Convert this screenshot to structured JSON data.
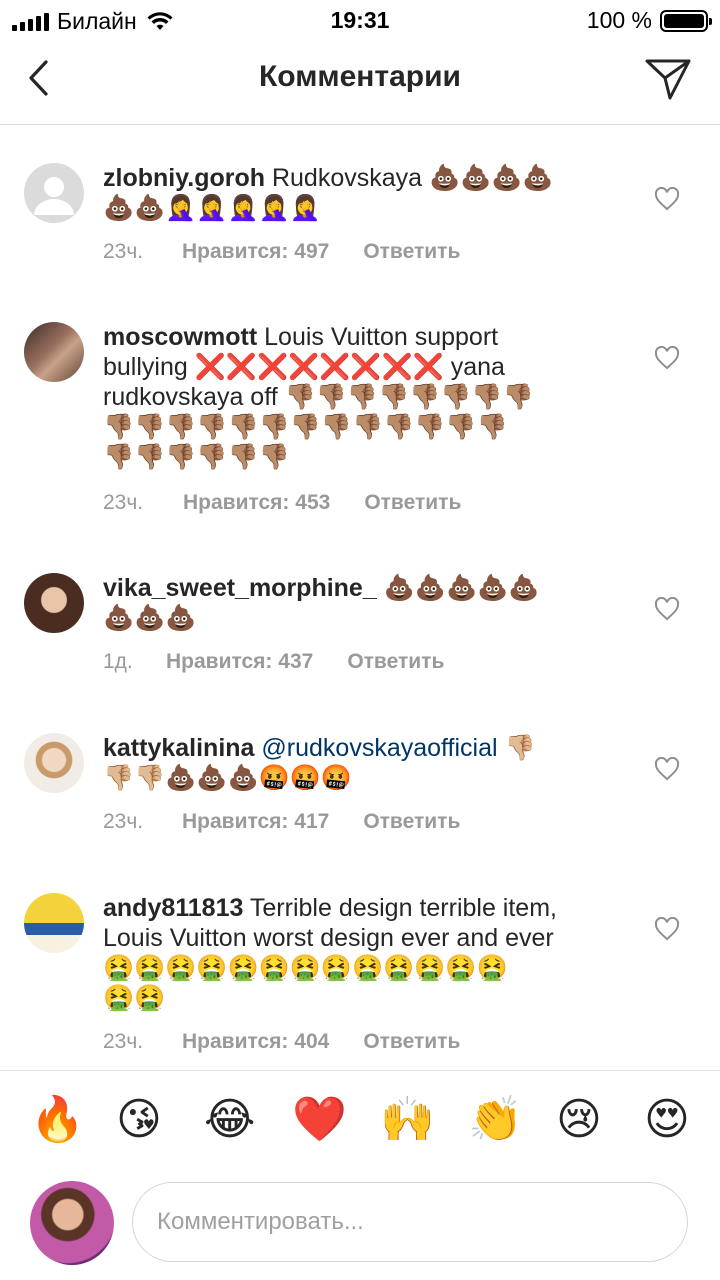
{
  "status": {
    "carrier": "Билайн",
    "time": "19:31",
    "battery": "100 %"
  },
  "nav": {
    "title": "Комментарии"
  },
  "comments": [
    {
      "username": "zlobniy.goroh",
      "text_line1": "Rudkovskaya 💩💩💩💩",
      "text_line2": "💩💩🤦‍♀️🤦‍♀️🤦‍♀️🤦‍♀️🤦‍♀️",
      "time": "23ч.",
      "likes": "Нравится: 497",
      "reply": "Ответить"
    },
    {
      "username": "moscowmott",
      "text_line1": "Louis Vuitton support",
      "text_line2": "bullying ❌❌❌❌❌❌❌❌ yana",
      "text_line3": "rudkovskaya off 👎🏽👎🏽👎🏽👎🏽👎🏽👎🏽👎🏽👎🏽",
      "text_line4": "👎🏽👎🏽👎🏽👎🏽👎🏽👎🏽👎🏽👎🏽👎🏽👎🏽👎🏽👎🏽👎🏽",
      "text_line5": "👎🏽👎🏽👎🏽👎🏽👎🏽👎🏽",
      "time": "23ч.",
      "likes": "Нравится: 453",
      "reply": "Ответить"
    },
    {
      "username": "vika_sweet_morphine_",
      "text_line1": "💩💩💩💩💩",
      "text_line2": "💩💩💩",
      "time": "1д.",
      "likes": "Нравится: 437",
      "reply": "Ответить"
    },
    {
      "username": "kattykalinina",
      "mention": "@rudkovskayaofficial",
      "text_line1": "👎🏼",
      "text_line2": "👎🏼👎🏼💩💩💩🤬🤬🤬",
      "time": "23ч.",
      "likes": "Нравится: 417",
      "reply": "Ответить"
    },
    {
      "username": "andy811813",
      "text_line1": "Terrible design terrible item,",
      "text_line2": "Louis Vuitton worst design ever and ever",
      "text_line3": "🤮🤮🤮🤮🤮🤮🤮🤮🤮🤮🤮🤮🤮",
      "text_line4": "🤮🤮",
      "time": "23ч.",
      "likes": "Нравится: 404",
      "reply": "Ответить"
    }
  ],
  "quick_emojis": [
    "🔥",
    "😘",
    "😂",
    "❤️",
    "🙌",
    "👏",
    "😢",
    "😍"
  ],
  "composer": {
    "placeholder": "Комментировать..."
  },
  "colors": {
    "mention": "#003569",
    "meta": "#999999",
    "divider": "#d8d8d8"
  }
}
